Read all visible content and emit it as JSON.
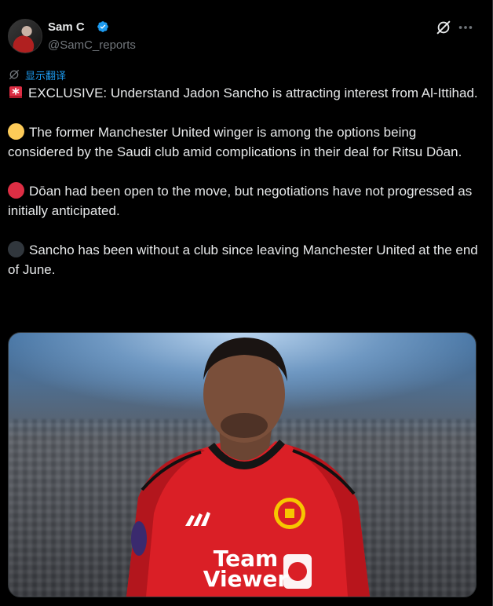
{
  "author": {
    "name": "Sam C",
    "handle": "@SamC_reports",
    "verified": true
  },
  "actions": {
    "grok_icon": "grok-icon",
    "more_icon": "more-icon"
  },
  "translate": {
    "label": "显示翻译"
  },
  "tweet": {
    "p1": "EXCLUSIVE: Understand Jadon Sancho is attracting interest from Al-Ittihad.",
    "p2": "The former Manchester United winger is among the options being considered by the Saudi club amid complications in their deal for Ritsu Dōan.",
    "p3": "Dōan had been open to the move, but negotiations have not progressed as initially anticipated.",
    "p4": "Sancho has been without a club since leaving Manchester United at the end of June."
  },
  "emojis": {
    "p1": "siren",
    "p2": "yellow-circle",
    "p3": "red-circle",
    "p4": "black-circle"
  },
  "media": {
    "shirt_text_line1": "Team",
    "shirt_text_line2": "Viewer"
  },
  "colors": {
    "background": "#000000",
    "text": "#e7e9ea",
    "muted": "#71767b",
    "link": "#1d9bf0",
    "verified": "#1d9bf0",
    "yellow_circle": "#fdcb58",
    "red_circle": "#dd2e44",
    "black_circle": "#31373d"
  }
}
